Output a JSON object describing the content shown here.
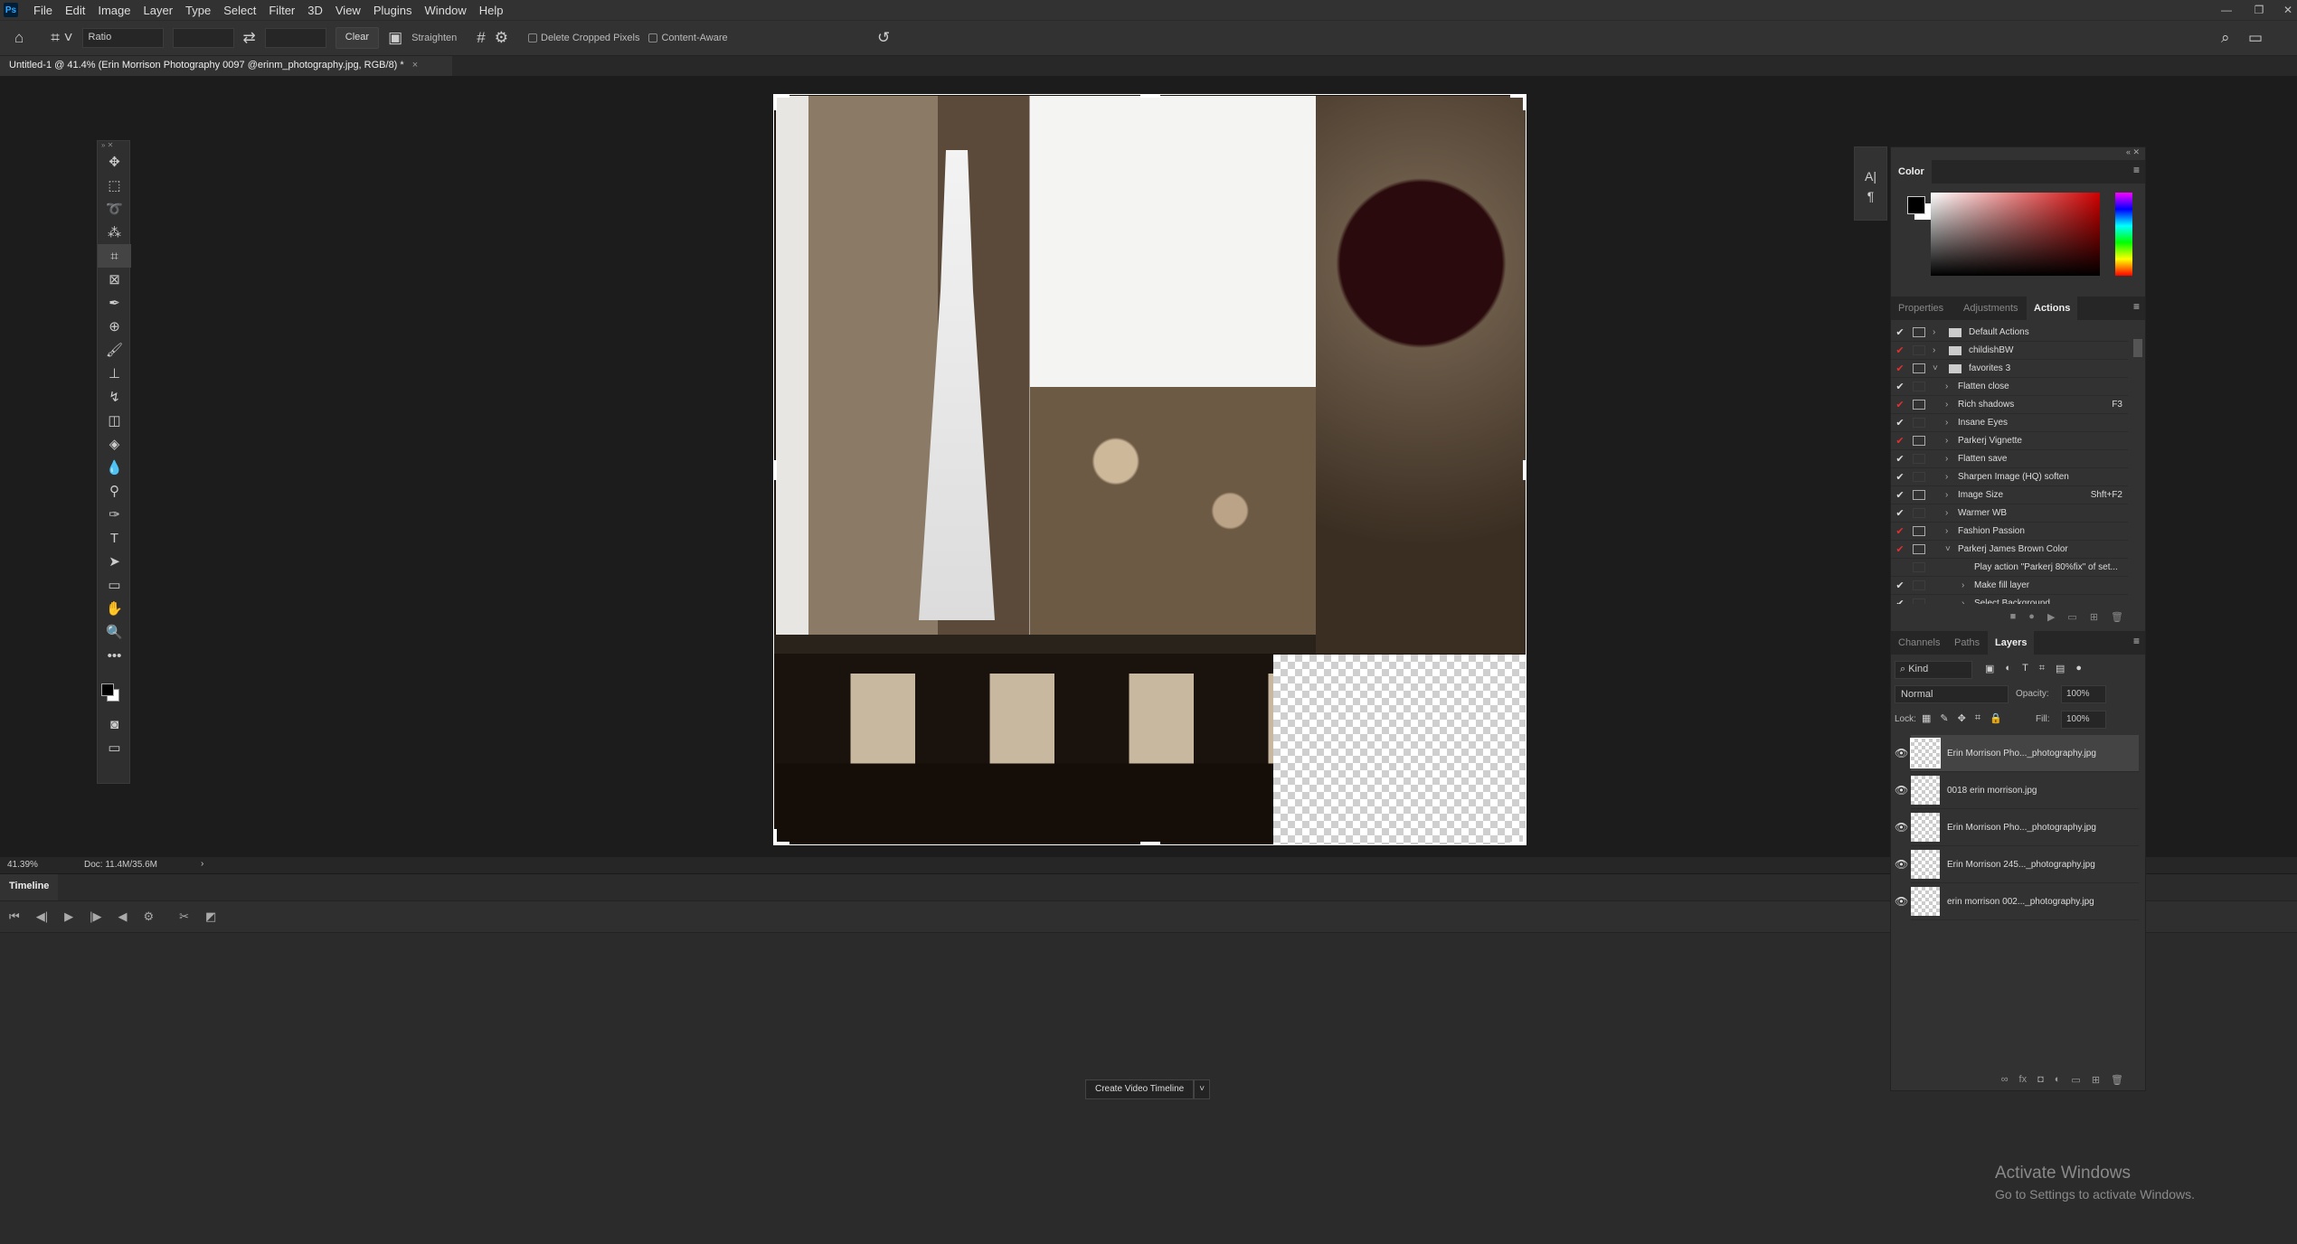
{
  "app": {
    "logo": "Ps"
  },
  "menu": [
    "File",
    "Edit",
    "Image",
    "Layer",
    "Type",
    "Select",
    "Filter",
    "3D",
    "View",
    "Plugins",
    "Window",
    "Help"
  ],
  "window_controls": [
    "—",
    "❐",
    "✕"
  ],
  "options": {
    "ratio": "Ratio",
    "width_value": "",
    "height_value": "",
    "clear": "Clear",
    "straighten": "Straighten",
    "delete_cropped": "Delete Cropped Pixels",
    "content_aware": "Content-Aware"
  },
  "document_tab": {
    "title": "Untitled-1 @ 41.4% (Erin Morrison Photography 0097 @erinm_photography.jpg, RGB/8) *",
    "close": "×"
  },
  "tools": [
    "move-icon",
    "marquee-icon",
    "lasso-icon",
    "magic-wand-icon",
    "crop-icon",
    "frame-icon",
    "eyedropper-icon",
    "healing-icon",
    "brush-icon",
    "stamp-icon",
    "history-brush-icon",
    "eraser-icon",
    "bucket-icon",
    "blur-icon",
    "dodge-icon",
    "pen-icon",
    "type-icon",
    "path-select-icon",
    "rectangle-icon",
    "hand-icon",
    "zoom-icon",
    "more-icon"
  ],
  "status": {
    "zoom": "41.39%",
    "doc": "Doc: 11.4M/35.6M"
  },
  "timeline": {
    "tab": "Timeline",
    "create_button": "Create Video Timeline"
  },
  "color_panel": {
    "title": "Color",
    "foreground": "#000000",
    "background": "#ffffff",
    "hue": "#d10000"
  },
  "mid_tabs": [
    "Properties",
    "Adjustments",
    "Actions"
  ],
  "actions": [
    {
      "name": "Default Actions",
      "check": "white",
      "dialog": true,
      "type": "set",
      "expanded": false
    },
    {
      "name": "childishBW",
      "check": "red",
      "dialog": false,
      "type": "set",
      "expanded": false
    },
    {
      "name": "favorites 3",
      "check": "red",
      "dialog": true,
      "type": "set",
      "expanded": true
    },
    {
      "name": "Flatten close",
      "check": "white",
      "dialog": false,
      "type": "action",
      "expanded": false
    },
    {
      "name": "Rich shadows",
      "check": "red",
      "dialog": true,
      "type": "action",
      "shortcut": "F3",
      "expanded": false
    },
    {
      "name": "Insane Eyes",
      "check": "white",
      "dialog": false,
      "type": "action",
      "expanded": false
    },
    {
      "name": "Parkerj Vignette",
      "check": "red",
      "dialog": true,
      "type": "action",
      "expanded": false
    },
    {
      "name": "Flatten save",
      "check": "white",
      "dialog": false,
      "type": "action",
      "expanded": false
    },
    {
      "name": "Sharpen Image (HQ) soften",
      "check": "white",
      "dialog": false,
      "type": "action",
      "expanded": false
    },
    {
      "name": "Image Size",
      "check": "white",
      "dialog": true,
      "type": "action",
      "shortcut": "Shft+F2",
      "expanded": false
    },
    {
      "name": "Warmer WB",
      "check": "white",
      "dialog": false,
      "type": "action",
      "expanded": false
    },
    {
      "name": "Fashion Passion",
      "check": "red",
      "dialog": true,
      "type": "action",
      "expanded": false
    },
    {
      "name": "Parkerj James Brown Color",
      "check": "red",
      "dialog": true,
      "type": "action",
      "expanded": true
    },
    {
      "name": "Play action \"Parkerj 80%fix\" of set...",
      "check": "none",
      "dialog": false,
      "type": "step",
      "expanded": false
    },
    {
      "name": "Make fill layer",
      "check": "white",
      "dialog": false,
      "type": "step",
      "expanded": false
    },
    {
      "name": "Select Background",
      "check": "white",
      "dialog": false,
      "type": "step",
      "expanded": false
    }
  ],
  "layers_tabs": [
    "Channels",
    "Paths",
    "Layers"
  ],
  "layers_controls": {
    "kind": "Kind",
    "blend": "Normal",
    "opacity_label": "Opacity:",
    "opacity": "100%",
    "lock_label": "Lock:",
    "fill_label": "Fill:",
    "fill": "100%"
  },
  "layers": [
    {
      "name": "Erin Morrison Pho..._photography.jpg",
      "selected": true
    },
    {
      "name": "0018 erin morrison.jpg",
      "selected": false
    },
    {
      "name": "Erin Morrison Pho..._photography.jpg",
      "selected": false
    },
    {
      "name": "Erin Morrison 245..._photography.jpg",
      "selected": false
    },
    {
      "name": "erin morrison 002..._photography.jpg",
      "selected": false
    }
  ],
  "watermark": {
    "title": "Activate Windows",
    "subtitle": "Go to Settings to activate Windows."
  }
}
